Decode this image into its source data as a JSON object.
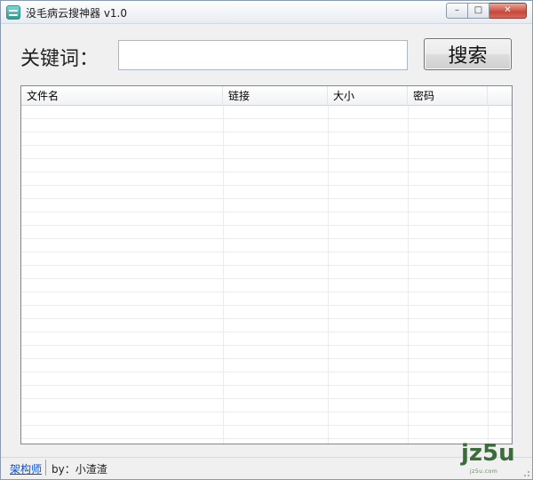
{
  "window": {
    "title": "没毛病云搜神器 v1.0",
    "controls": {
      "minimize": "–",
      "maximize": "□",
      "close": "✕"
    }
  },
  "search": {
    "label": "关键词：",
    "value": "",
    "placeholder": "",
    "button_label": "搜索"
  },
  "table": {
    "columns": [
      "文件名",
      "链接",
      "大小",
      "密码"
    ],
    "rows": []
  },
  "statusbar": {
    "link_label": "架构师",
    "credit": "by：小渣渣"
  },
  "watermark": {
    "text": "jz5u",
    "subtext": "jz5u.com"
  },
  "colors": {
    "accent_link": "#0b4fd6",
    "close_button": "#c8473a",
    "watermark": "#3a6d3a"
  },
  "icons": {
    "app": "app-logo-icon",
    "minimize": "minimize-icon",
    "maximize": "maximize-icon",
    "close": "close-icon"
  }
}
